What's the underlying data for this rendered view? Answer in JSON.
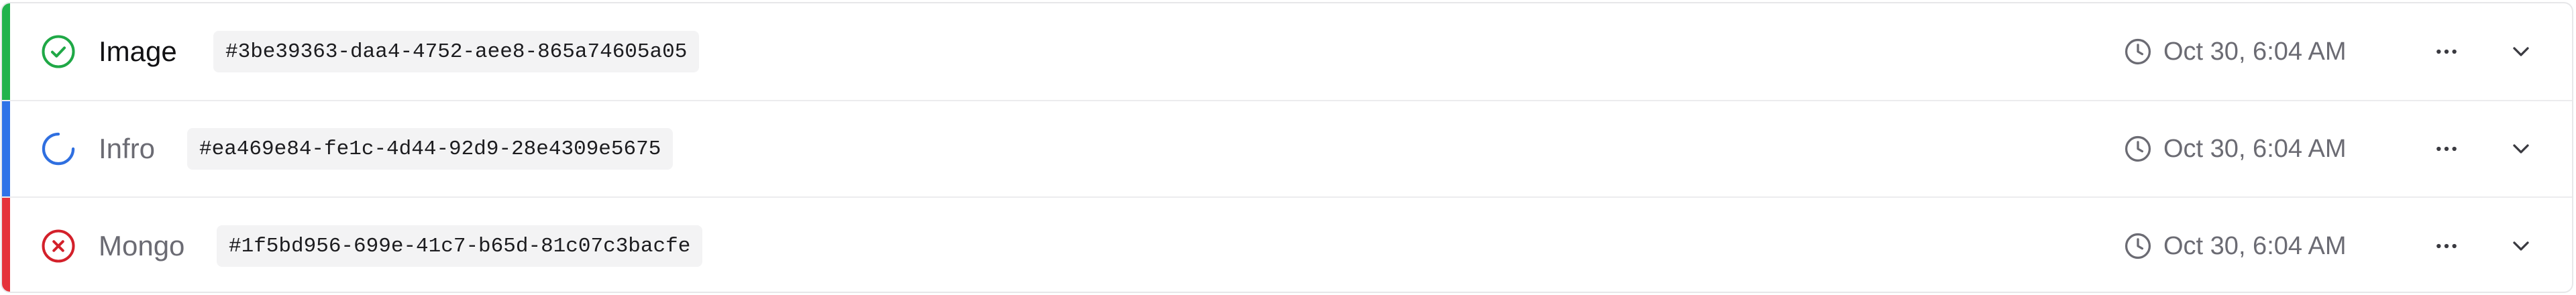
{
  "runs": [
    {
      "name": "Image",
      "id": "#3be39363-daa4-4752-aee8-865a74605a05",
      "time": "Oct 30, 6:04 AM",
      "status": "success",
      "status_icon": "check-circle-icon",
      "accent_color": "#22b34c"
    },
    {
      "name": "Infro",
      "id": "#ea469e84-fe1c-4d44-92d9-28e4309e5675",
      "time": "Oct 30, 6:04 AM",
      "status": "running",
      "status_icon": "loading-spinner-icon",
      "accent_color": "#2f73e8"
    },
    {
      "name": "Mongo",
      "id": "#1f5bd956-699e-41c7-b65d-81c07c3bacfe",
      "time": "Oct 30, 6:04 AM",
      "status": "failed",
      "status_icon": "x-circle-icon",
      "accent_color": "#e5333b"
    }
  ],
  "icons": {
    "time": "clock-icon",
    "more": "more-horizontal-icon",
    "expand": "chevron-down-icon"
  }
}
